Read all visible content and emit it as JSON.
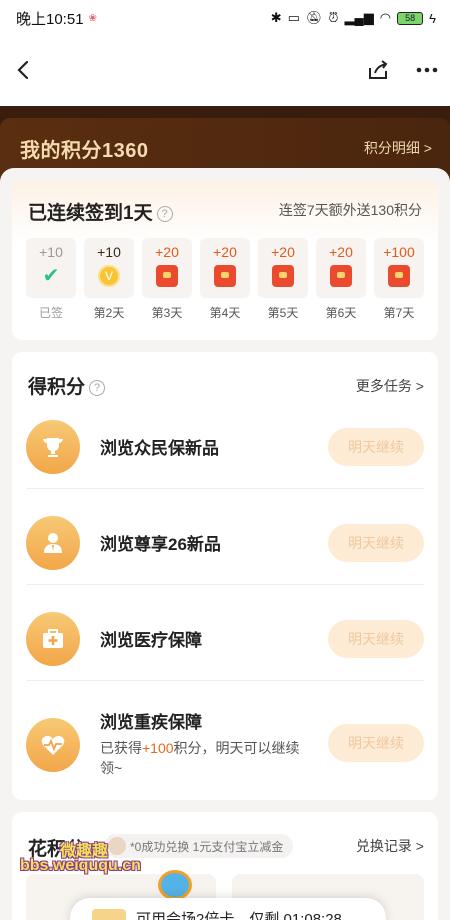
{
  "status_bar": {
    "time": "晚上10:51",
    "battery": "58"
  },
  "nav": {
    "back_icon": "back-chevron-icon",
    "share_icon": "share-icon",
    "more_icon": "more-dots-icon"
  },
  "points": {
    "title": "我的积分1360",
    "detail_link": "积分明细 >"
  },
  "checkin": {
    "title": "已连续签到1天",
    "bonus_text": "连签7天额外送130积分",
    "days": [
      {
        "points": "+10",
        "label": "已签",
        "state": "checked"
      },
      {
        "points": "+10",
        "label": "第2天",
        "state": "coin"
      },
      {
        "points": "+20",
        "label": "第3天",
        "state": "redpacket"
      },
      {
        "points": "+20",
        "label": "第4天",
        "state": "redpacket"
      },
      {
        "points": "+20",
        "label": "第5天",
        "state": "redpacket"
      },
      {
        "points": "+20",
        "label": "第6天",
        "state": "redpacket"
      },
      {
        "points": "+100",
        "label": "第7天",
        "state": "redpacket"
      }
    ]
  },
  "earn": {
    "title": "得积分",
    "more_link": "更多任务 >",
    "tasks": [
      {
        "name": "浏览众民保新品",
        "button": "明天继续",
        "icon": "trophy-icon"
      },
      {
        "name": "浏览尊享26新品",
        "button": "明天继续",
        "icon": "person-icon"
      },
      {
        "name": "浏览医疗保障",
        "button": "明天继续",
        "icon": "medical-kit-icon"
      },
      {
        "name": "浏览重疾保障",
        "button": "明天继续",
        "icon": "heart-pulse-icon",
        "desc_prefix": "已获得",
        "desc_highlight": "+100",
        "desc_suffix": "积分，明天可以继续领~"
      }
    ]
  },
  "spend": {
    "title": "花积分",
    "ticker": "*0成功兑换 1元支付宝立减金",
    "records_link": "兑换记录 >"
  },
  "promo": {
    "text": "可用会场2倍卡，仅剩 01:08:28"
  },
  "watermark": {
    "cn": "微趣趣",
    "url": "bbs.weiququ.cn"
  },
  "colors": {
    "header_bg": "#3a1e0d",
    "accent": "#e56a1f",
    "gold_text": "#f6dbb0",
    "button_bg": "#fdebd6"
  }
}
